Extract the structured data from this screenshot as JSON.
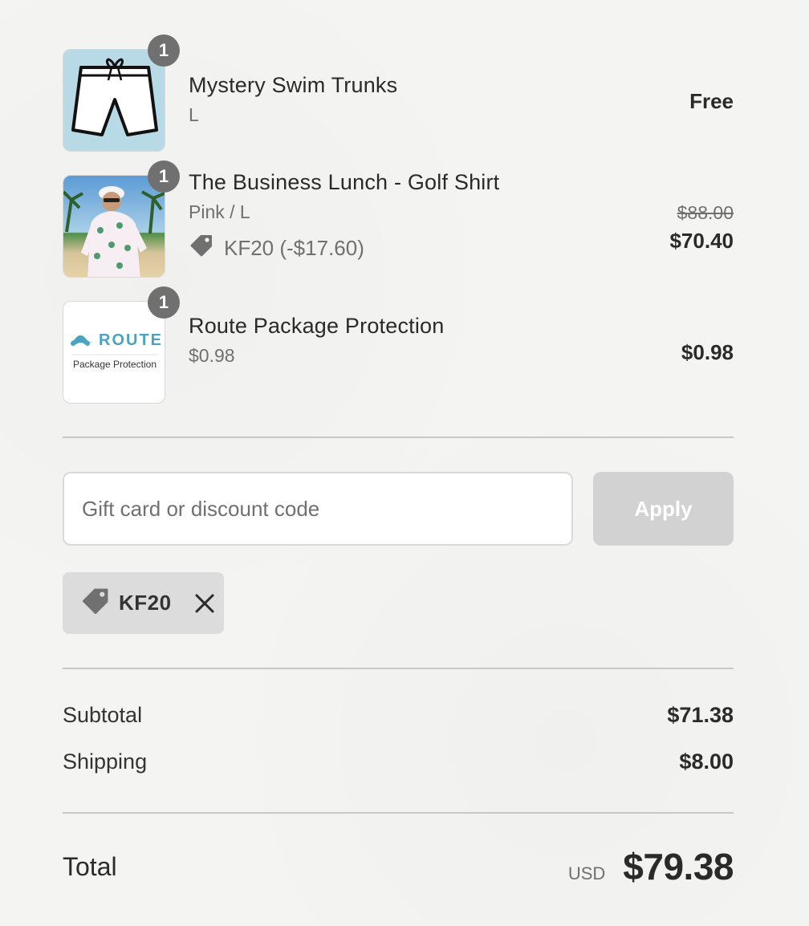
{
  "items": [
    {
      "name": "Mystery Swim Trunks",
      "variant": "L",
      "quantity": "1",
      "price": "Free",
      "image": "swim-trunks-icon"
    },
    {
      "name": "The Business Lunch - Golf Shirt",
      "variant": "Pink / L",
      "quantity": "1",
      "original_price": "$88.00",
      "price": "$70.40",
      "discount": "KF20 (-$17.60)",
      "image": "golf-shirt-photo"
    },
    {
      "name": "Route Package Protection",
      "variant": "$0.98",
      "quantity": "1",
      "price": "$0.98",
      "image": "route-logo",
      "logo_text": "ROUTE",
      "logo_subtext": "Package Protection"
    }
  ],
  "discount_form": {
    "placeholder": "Gift card or discount code",
    "value": "",
    "apply_label": "Apply"
  },
  "applied_discount": {
    "code": "KF20"
  },
  "totals": {
    "subtotal_label": "Subtotal",
    "subtotal": "$71.38",
    "shipping_label": "Shipping",
    "shipping": "$8.00",
    "total_label": "Total",
    "currency": "USD",
    "total": "$79.38"
  },
  "colors": {
    "badge": "#707070",
    "apply_button": "#d2d2d2",
    "tag_background": "#dcdcdc",
    "route_accent": "#4aa4c0"
  }
}
